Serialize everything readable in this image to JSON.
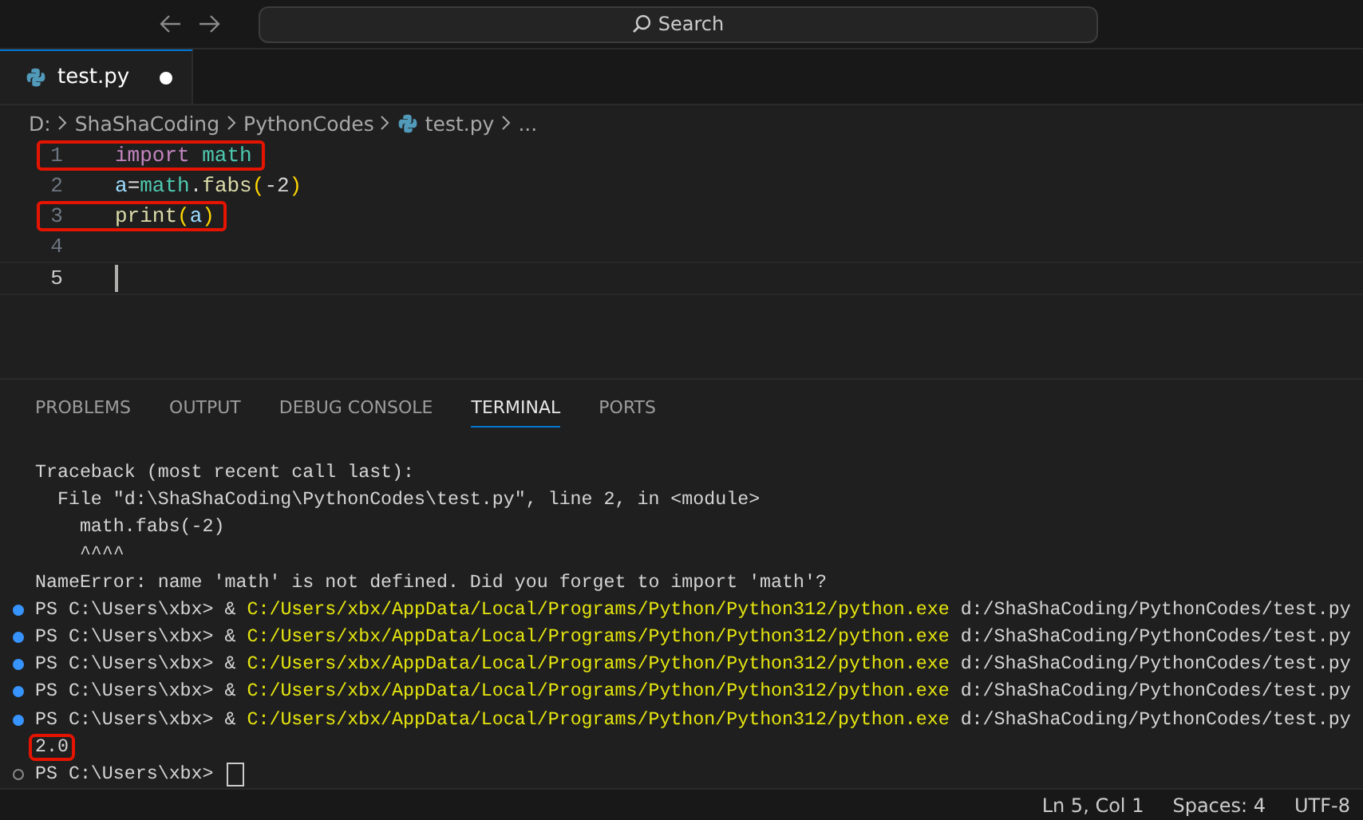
{
  "title_bar": {
    "search": {
      "placeholder": "Search"
    }
  },
  "editor_tabs": [
    {
      "label": "test.py",
      "selected": true,
      "modified": true
    }
  ],
  "breadcrumb": [
    "D:",
    "ShaShaCoding",
    "PythonCodes",
    "test.py",
    "..."
  ],
  "code_lines": [
    {
      "number": "1",
      "highlighted": true,
      "active": false,
      "tokens": [
        {
          "kind": "keyword",
          "text": "import"
        },
        {
          "kind": "module",
          "text": "math"
        }
      ]
    },
    {
      "number": "2",
      "highlighted": false,
      "active": false,
      "tokens": [
        {
          "kind": "variable",
          "text": "a"
        },
        {
          "kind": "plain",
          "text": "="
        },
        {
          "kind": "module",
          "text": "math"
        },
        {
          "kind": "plain",
          "text": "."
        },
        {
          "kind": "function",
          "text": "fabs"
        },
        {
          "kind": "bracket",
          "text": "("
        },
        {
          "kind": "plain",
          "text": "-2"
        },
        {
          "kind": "bracket",
          "text": ")"
        }
      ]
    },
    {
      "number": "3",
      "highlighted": true,
      "active": false,
      "tokens": [
        {
          "kind": "function",
          "text": "print"
        },
        {
          "kind": "bracket",
          "text": "("
        },
        {
          "kind": "variable",
          "text": "a"
        },
        {
          "kind": "bracket",
          "text": ")"
        }
      ]
    },
    {
      "number": "4",
      "highlighted": false,
      "active": false
    },
    {
      "number": "5",
      "highlighted": false,
      "active": true
    }
  ],
  "panel_tabs": [
    {
      "label": "PROBLEMS",
      "selected": false
    },
    {
      "label": "OUTPUT",
      "selected": false
    },
    {
      "label": "DEBUG CONSOLE",
      "selected": false
    },
    {
      "label": "TERMINAL",
      "selected": true
    },
    {
      "label": "PORTS",
      "selected": false
    }
  ],
  "terminal_lines": [
    {
      "highlighted": false,
      "cursor": false,
      "tokens": [
        {
          "kind": "plain",
          "text": "Traceback (most recent call last):"
        }
      ]
    },
    {
      "highlighted": false,
      "cursor": false,
      "tokens": [
        {
          "kind": "plain",
          "text": "  File \"d:\\ShaShaCoding\\PythonCodes\\test.py\", line 2, in <module>"
        }
      ]
    },
    {
      "highlighted": false,
      "cursor": false,
      "tokens": [
        {
          "kind": "plain",
          "text": "    math.fabs(-2)"
        }
      ]
    },
    {
      "highlighted": false,
      "cursor": false,
      "tokens": [
        {
          "kind": "plain",
          "text": "    ^^^^"
        }
      ]
    },
    {
      "highlighted": false,
      "cursor": false,
      "tokens": [
        {
          "kind": "plain",
          "text": "NameError: name 'math' is not defined. Did you forget to import 'math'?"
        }
      ]
    },
    {
      "status_dot": {
        "filled": true
      },
      "highlighted": false,
      "cursor": false,
      "tokens": [
        {
          "kind": "plain",
          "text": "PS C:\\Users\\xbx> & "
        },
        {
          "kind": "path",
          "text": "C:/Users/xbx/AppData/Local/Programs/Python/Python312/python.exe"
        },
        {
          "kind": "plain",
          "text": " d:/ShaShaCoding/PythonCodes/test.py"
        }
      ]
    },
    {
      "status_dot": {
        "filled": true
      },
      "highlighted": false,
      "cursor": false,
      "tokens": [
        {
          "kind": "plain",
          "text": "PS C:\\Users\\xbx> & "
        },
        {
          "kind": "path",
          "text": "C:/Users/xbx/AppData/Local/Programs/Python/Python312/python.exe"
        },
        {
          "kind": "plain",
          "text": " d:/ShaShaCoding/PythonCodes/test.py"
        }
      ]
    },
    {
      "status_dot": {
        "filled": true
      },
      "highlighted": false,
      "cursor": false,
      "tokens": [
        {
          "kind": "plain",
          "text": "PS C:\\Users\\xbx> & "
        },
        {
          "kind": "path",
          "text": "C:/Users/xbx/AppData/Local/Programs/Python/Python312/python.exe"
        },
        {
          "kind": "plain",
          "text": " d:/ShaShaCoding/PythonCodes/test.py"
        }
      ]
    },
    {
      "status_dot": {
        "filled": true
      },
      "highlighted": false,
      "cursor": false,
      "tokens": [
        {
          "kind": "plain",
          "text": "PS C:\\Users\\xbx> & "
        },
        {
          "kind": "path",
          "text": "C:/Users/xbx/AppData/Local/Programs/Python/Python312/python.exe"
        },
        {
          "kind": "plain",
          "text": " d:/ShaShaCoding/PythonCodes/test.py"
        }
      ]
    },
    {
      "status_dot": {
        "filled": true
      },
      "highlighted": false,
      "cursor": false,
      "tokens": [
        {
          "kind": "plain",
          "text": "PS C:\\Users\\xbx> & "
        },
        {
          "kind": "path",
          "text": "C:/Users/xbx/AppData/Local/Programs/Python/Python312/python.exe"
        },
        {
          "kind": "plain",
          "text": " d:/ShaShaCoding/PythonCodes/test.py"
        }
      ]
    },
    {
      "highlighted": true,
      "cursor": false,
      "tokens": [
        {
          "kind": "plain",
          "text": "2.0"
        }
      ]
    },
    {
      "status_dot": {
        "filled": false
      },
      "highlighted": false,
      "cursor": true,
      "tokens": [
        {
          "kind": "plain",
          "text": "PS C:\\Users\\xbx>"
        }
      ]
    }
  ],
  "status_bar": [
    "Ln 5, Col 1",
    "Spaces: 4",
    "UTF-8"
  ]
}
